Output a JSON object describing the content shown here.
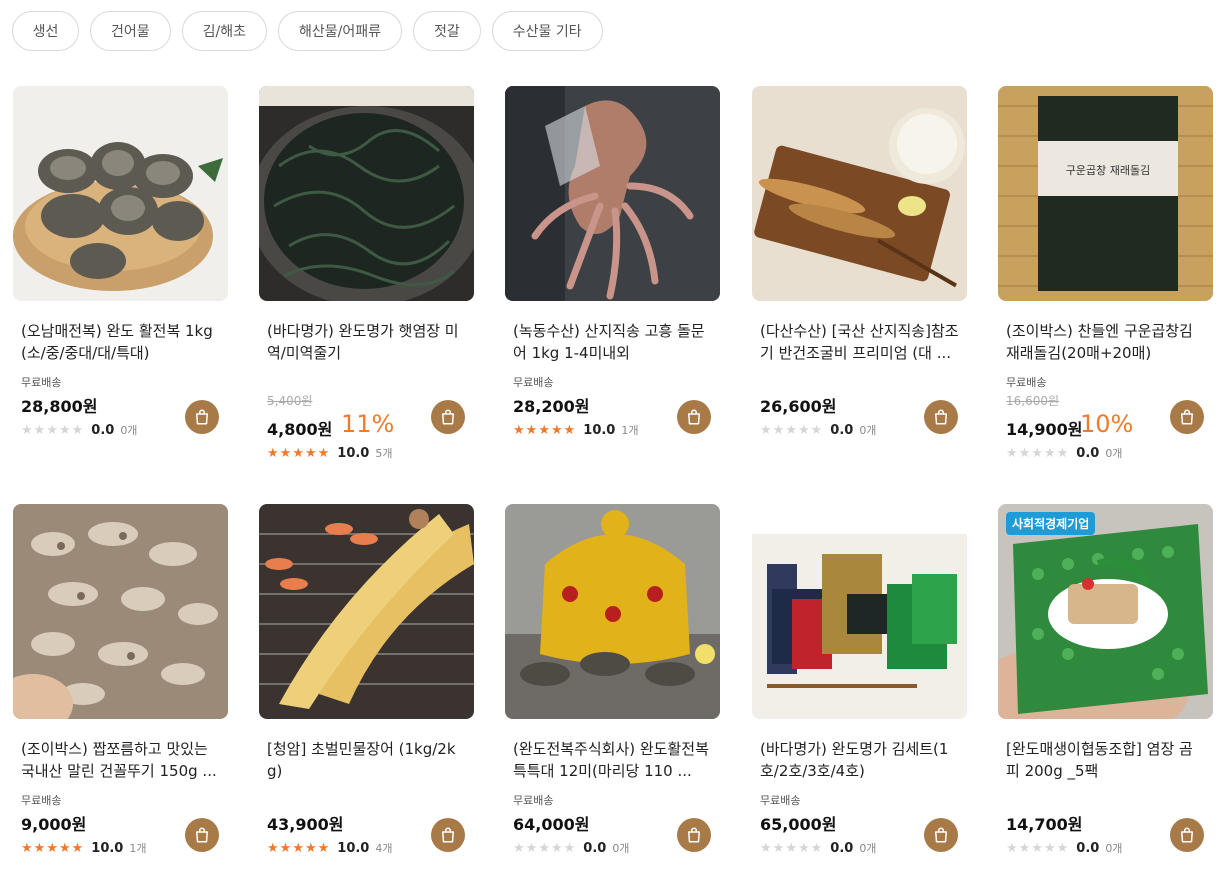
{
  "categories": [
    "생선",
    "건어물",
    "김/해초",
    "해산물/어패류",
    "젓갈",
    "수산물 기타"
  ],
  "shipping_label": "무료배송",
  "colors": {
    "accent": "#f07a2c",
    "cart": "#a87a48",
    "badge": "#1e9cd7"
  },
  "products": [
    {
      "title": "(오남매전복) 완도 활전복 1kg (소/중/중대/대/특대)",
      "free_shipping": true,
      "original_price": "",
      "price": "28,800원",
      "discount": "",
      "stars": 0,
      "score": "0.0",
      "reviews": "0개",
      "badge": "",
      "image": "abalone-basket"
    },
    {
      "title": "(바다명가) 완도명가 햇염장 미역/미역줄기",
      "free_shipping": false,
      "original_price": "5,400원",
      "price": "4,800원",
      "discount": "11%",
      "stars": 5,
      "score": "10.0",
      "reviews": "5개",
      "badge": "",
      "image": "seaweed-bowl"
    },
    {
      "title": "(녹동수산) 산지직송 고흥 돌문어 1kg 1-4미내외",
      "free_shipping": true,
      "original_price": "",
      "price": "28,200원",
      "discount": "",
      "stars": 5,
      "score": "10.0",
      "reviews": "1개",
      "badge": "",
      "image": "octopus"
    },
    {
      "title": "(다산수산) [국산 산지직송]참조기 반건조굴비 프리미엄 (대 ...",
      "free_shipping": false,
      "original_price": "",
      "price": "26,600원",
      "discount": "",
      "stars": 0,
      "score": "0.0",
      "reviews": "0개",
      "badge": "",
      "image": "dried-croaker"
    },
    {
      "title": "(조이박스) 찬들엔 구운곱창김 재래돌김(20매+20매)",
      "free_shipping": true,
      "original_price": "16,600원",
      "price": "14,900원",
      "discount": "10%",
      "stars": 0,
      "score": "0.0",
      "reviews": "0개",
      "badge": "",
      "image": "laver-pack"
    },
    {
      "title": "(조이박스) 짭쪼름하고 맛있는 국내산 말린 건꼴뚜기 150g ...",
      "free_shipping": true,
      "original_price": "",
      "price": "9,000원",
      "discount": "",
      "stars": 5,
      "score": "10.0",
      "reviews": "1개",
      "badge": "",
      "image": "dried-squid"
    },
    {
      "title": "[청암] 초벌민물장어 (1kg/2kg)",
      "free_shipping": false,
      "original_price": "",
      "price": "43,900원",
      "discount": "",
      "stars": 5,
      "score": "10.0",
      "reviews": "4개",
      "badge": "",
      "image": "grilled-eel"
    },
    {
      "title": "(완도전복주식회사) 완도활전복 특특대 12미(마리당 110 ...",
      "free_shipping": true,
      "original_price": "",
      "price": "64,000원",
      "discount": "",
      "stars": 0,
      "score": "0.0",
      "reviews": "0개",
      "badge": "",
      "image": "gift-abalone"
    },
    {
      "title": "(바다명가) 완도명가 김세트(1호/2호/3호/4호)",
      "free_shipping": true,
      "original_price": "",
      "price": "65,000원",
      "discount": "",
      "stars": 0,
      "score": "0.0",
      "reviews": "0개",
      "badge": "",
      "image": "laver-giftset"
    },
    {
      "title": "[완도매생이협동조합] 염장 곰피 200g _5팩",
      "free_shipping": false,
      "original_price": "",
      "price": "14,700원",
      "discount": "",
      "stars": 0,
      "score": "0.0",
      "reviews": "0개",
      "badge": "사회적경제기업",
      "image": "gompi-wrap"
    }
  ]
}
